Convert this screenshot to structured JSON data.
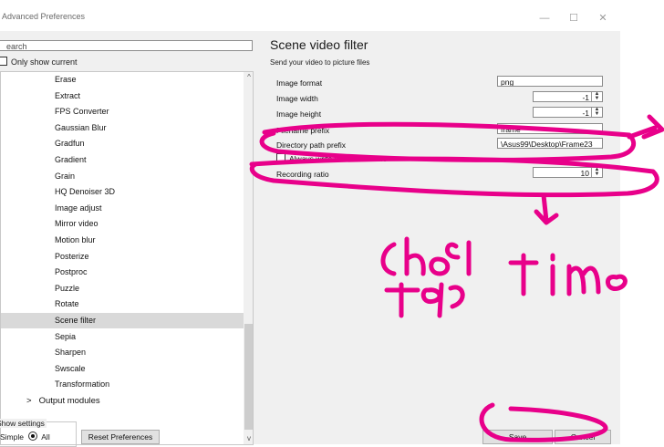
{
  "window": {
    "title": "Advanced Preferences",
    "minimize": "—",
    "maximize": "☐",
    "close": "✕"
  },
  "sidebar": {
    "search_value": "earch",
    "only_show_current": "Only show current",
    "items": [
      "Erase",
      "Extract",
      "FPS Converter",
      "Gaussian Blur",
      "Gradfun",
      "Gradient",
      "Grain",
      "HQ Denoiser 3D",
      "Image adjust",
      "Mirror video",
      "Motion blur",
      "Posterize",
      "Postproc",
      "Puzzle",
      "Rotate",
      "Scene filter",
      "Sepia",
      "Sharpen",
      "Swscale",
      "Transformation"
    ],
    "selected_item": "Scene filter",
    "parent_item": "Output modules",
    "expander": ">",
    "scroll_up": "^",
    "scroll_down": "v"
  },
  "main": {
    "title": "Scene video filter",
    "subtitle": "Send your video to picture files",
    "options": {
      "image_format": {
        "label": "Image format",
        "value": "png"
      },
      "image_width": {
        "label": "Image width",
        "value": "-1"
      },
      "image_height": {
        "label": "Image height",
        "value": "-1"
      },
      "filename_prefix": {
        "label": "Filename prefix",
        "value": "frame"
      },
      "directory_path_prefix": {
        "label": "Directory path prefix",
        "value": "\\Asus99\\Desktop\\Frame23"
      },
      "always_write": {
        "label": "Always write to the same file"
      },
      "recording_ratio": {
        "label": "Recording ratio",
        "value": "10"
      }
    },
    "spin_up": "▲",
    "spin_down": "▼"
  },
  "footer": {
    "show_settings": "Show settings",
    "simple": "Simple",
    "all": "All",
    "reset": "Reset Preferences",
    "save": "Save",
    "cancel": "Cancel"
  },
  "annotation": {
    "color": "#e8008a",
    "handwriting": "Choose time"
  }
}
